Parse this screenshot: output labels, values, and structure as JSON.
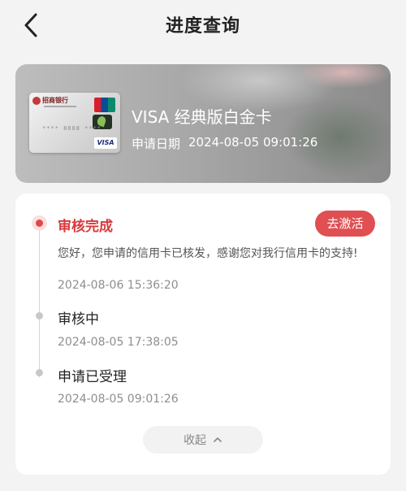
{
  "header": {
    "title": "进度查询"
  },
  "card": {
    "bank_name": "招商银行",
    "card_number_masked": "**** 8888 ****",
    "mini_visa_label": "VISA",
    "name": "VISA 经典版白金卡",
    "apply_label": "申请日期",
    "apply_date": "2024-08-05 09:01:26"
  },
  "progress": {
    "steps": [
      {
        "title": "审核完成",
        "description": "您好，您申请的信用卡已核发，感谢您对我行信用卡的支持!",
        "time": "2024-08-06 15:36:20",
        "active": true
      },
      {
        "title": "审核中",
        "time": "2024-08-05 17:38:05",
        "active": false
      },
      {
        "title": "申请已受理",
        "time": "2024-08-05 09:01:26",
        "active": false
      }
    ],
    "activate_label": "去激活",
    "collapse_label": "收起"
  },
  "colors": {
    "accent": "#e04f52",
    "active_text": "#d9393d",
    "background": "#f3f3f3"
  },
  "icons": {
    "back": "chevron-left-icon",
    "collapse": "chevron-up-icon"
  }
}
